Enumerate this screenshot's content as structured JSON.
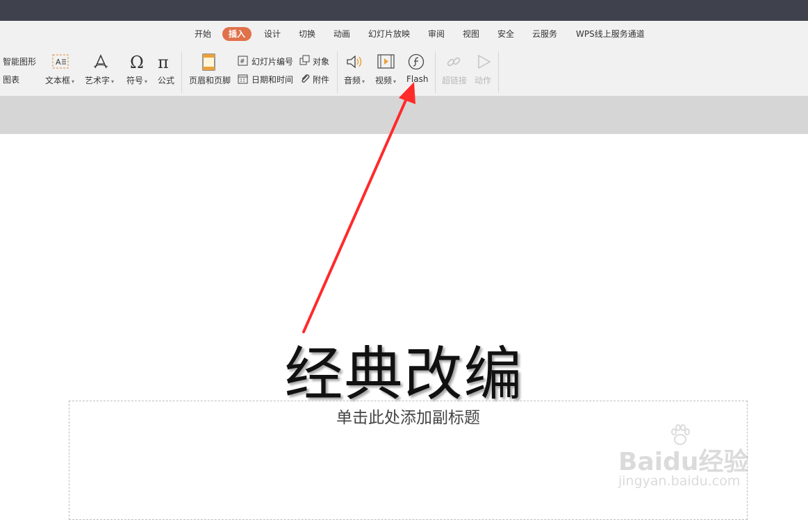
{
  "menu": {
    "tabs": [
      "开始",
      "插入",
      "设计",
      "切换",
      "动画",
      "幻灯片放映",
      "审阅",
      "视图",
      "安全",
      "云服务",
      "WPS线上服务通道"
    ],
    "active": "插入"
  },
  "ribbon": {
    "smart_art": "智能图形",
    "chart": "图表",
    "textbox": "文本框",
    "wordart": "艺术字",
    "symbol": "符号",
    "formula": "公式",
    "header_footer": "页眉和页脚",
    "slide_number": "幻灯片编号",
    "object": "对象",
    "date_time": "日期和时间",
    "attachment": "附件",
    "audio": "音频",
    "video": "视频",
    "flash": "Flash",
    "hyperlink": "超链接",
    "action": "动作"
  },
  "slide": {
    "title": "经典改编",
    "subtitle_placeholder": "单击此处添加副标题"
  },
  "watermark": {
    "brand": "Baidu经验",
    "url": "jingyan.baidu.com"
  },
  "colors": {
    "titlebar": "#3f424c",
    "active_tab": "#e0714a",
    "arrow": "#ff2a2a"
  }
}
